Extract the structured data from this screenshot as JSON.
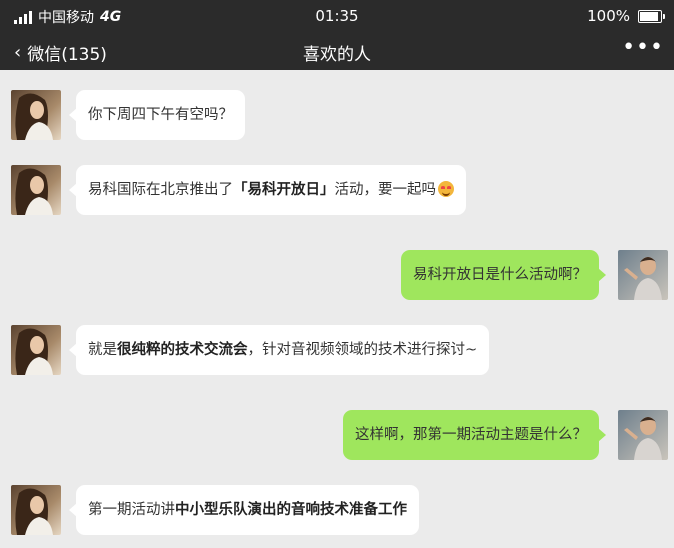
{
  "status_bar": {
    "carrier": "中国移动",
    "network": "4G",
    "time": "01:35",
    "battery_text": "100%",
    "battery_level": 1.0
  },
  "nav": {
    "back_label": "微信(135)",
    "title": "喜欢的人",
    "more_icon": "more-dots-icon"
  },
  "colors": {
    "topbar": "#2b2b2b",
    "chat_bg": "#ebebeb",
    "outgoing_bubble": "#9fe65d",
    "incoming_bubble": "#ffffff"
  },
  "messages": [
    {
      "side": "left",
      "parts": [
        {
          "text": "你下周四下午有空吗？",
          "bold": false
        }
      ]
    },
    {
      "side": "left",
      "parts": [
        {
          "text": "易科国际在北京推出了",
          "bold": false
        },
        {
          "text": "「易科开放日」",
          "bold": true
        },
        {
          "text": "活动，要一起吗",
          "bold": false
        }
      ],
      "emoji": "heart-eyes-emoji"
    },
    {
      "side": "right",
      "parts": [
        {
          "text": "易科开放日是什么活动啊？",
          "bold": false
        }
      ]
    },
    {
      "side": "left",
      "parts": [
        {
          "text": "就是",
          "bold": false
        },
        {
          "text": "很纯粹的技术交流会",
          "bold": true
        },
        {
          "text": "，针对音视频领域的技术进行探讨~",
          "bold": false
        }
      ]
    },
    {
      "side": "right",
      "parts": [
        {
          "text": "这样啊，那第一期活动主题是什么？",
          "bold": false
        }
      ]
    },
    {
      "side": "left",
      "parts": [
        {
          "text": "第一期活动讲",
          "bold": false
        },
        {
          "text": "中小型乐队演出的音响技术准备工作",
          "bold": true
        }
      ]
    }
  ]
}
